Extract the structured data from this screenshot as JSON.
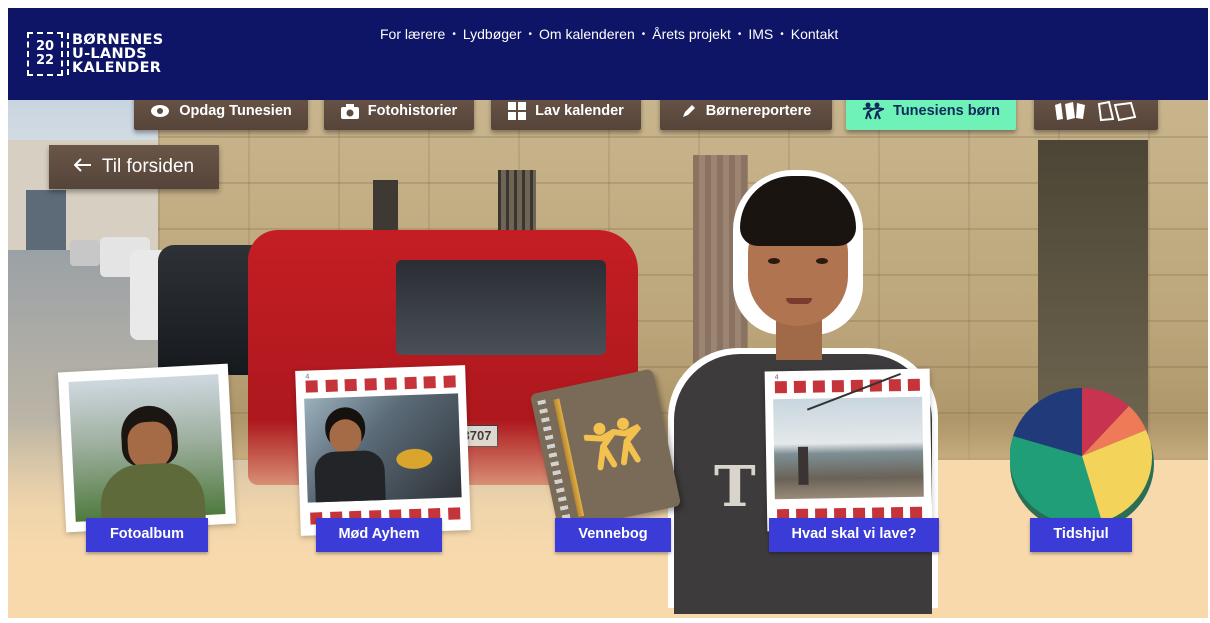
{
  "logo": {
    "year_top": "20",
    "year_bottom": "22",
    "line1": "BØRNENES",
    "line2": "U-LANDS",
    "line3": "KALENDER"
  },
  "topnav": [
    "For lærere",
    "Lydbøger",
    "Om kalenderen",
    "Årets projekt",
    "IMS",
    "Kontakt"
  ],
  "topnav_separator": "•",
  "tabs": [
    {
      "label": "Opdag Tunesien",
      "icon": "eye-icon"
    },
    {
      "label": "Fotohistorier",
      "icon": "camera-icon"
    },
    {
      "label": "Lav kalender",
      "icon": "grid-icon"
    },
    {
      "label": "Børnereportere",
      "icon": "pen-icon"
    },
    {
      "label": "Tunesiens børn",
      "icon": "kids-icon",
      "active": true
    },
    {
      "label": "",
      "icon": "ramasjang-logo"
    }
  ],
  "back": {
    "label": "Til forsiden",
    "icon": "arrow-left-icon"
  },
  "items": [
    {
      "label": "Fotoalbum"
    },
    {
      "label": "Mød Ayhem"
    },
    {
      "label": "Vennebog"
    },
    {
      "label": "Hvad skal vi lave?"
    },
    {
      "label": "Tidshjul"
    }
  ],
  "film_number": "4",
  "van_plate": "3707",
  "colors": {
    "topbar": "#0e1466",
    "label": "#3b3bd8",
    "active_tab": "#6ff2b8",
    "board": "#5e4b3f",
    "background": "#f7d9ac"
  },
  "pie_colors": [
    "#223a7a",
    "#d8435a",
    "#f07a55",
    "#f5d45a",
    "#24a17a"
  ]
}
